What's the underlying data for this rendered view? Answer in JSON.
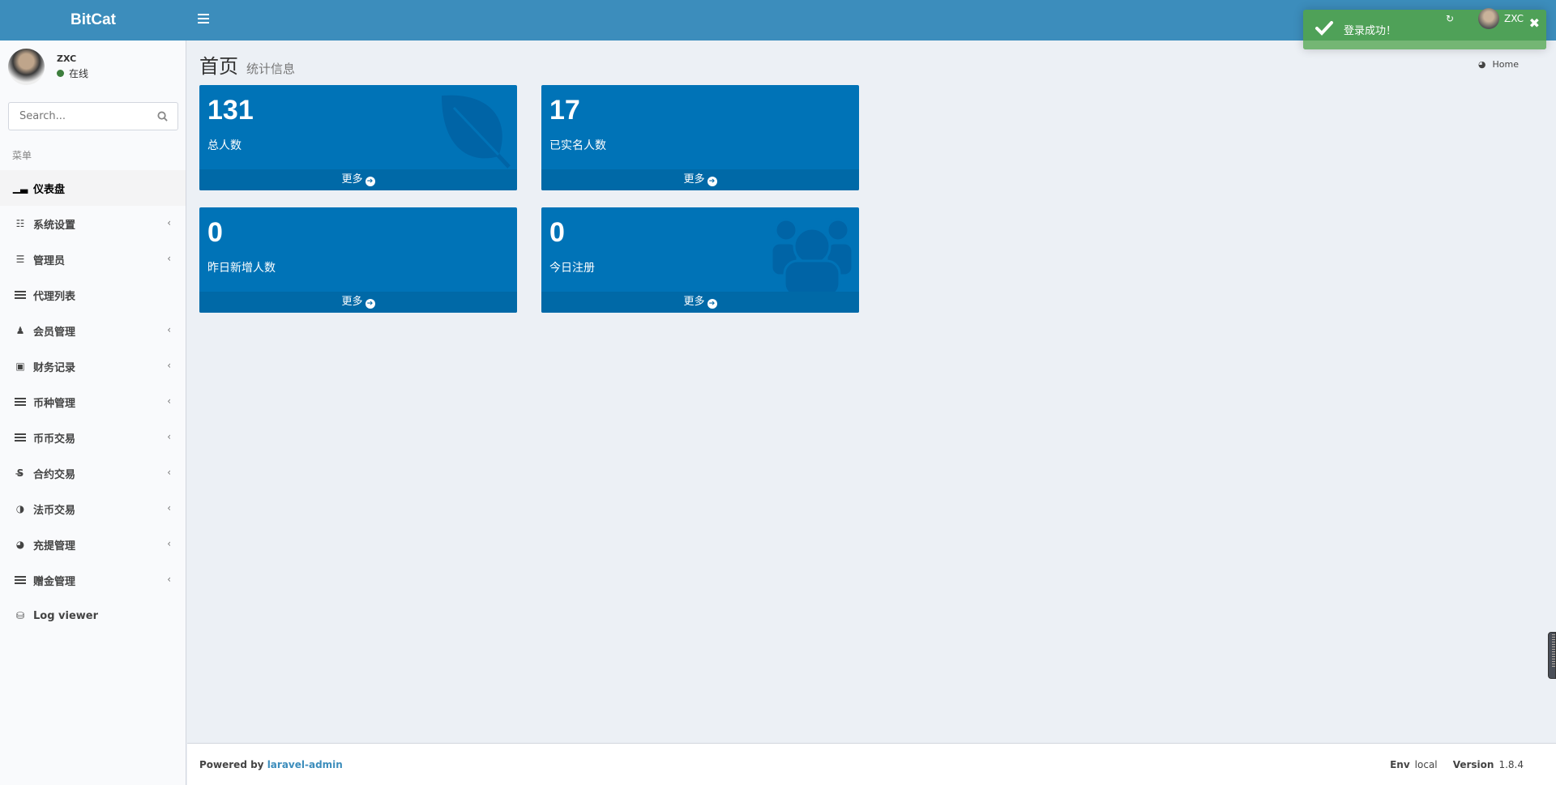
{
  "header": {
    "logo": "BitCat",
    "user_name": "ZXC"
  },
  "sidebar": {
    "user": {
      "name": "ZXC",
      "status": "在线",
      "status_color": "#3d7e3d"
    },
    "search": {
      "placeholder": "Search..."
    },
    "menu_header": "菜单",
    "items": [
      {
        "label": "仪表盘",
        "icon": "bar-chart-icon",
        "active": true,
        "has_children": false
      },
      {
        "label": "系统设置",
        "icon": "sliders-icon",
        "has_children": true
      },
      {
        "label": "管理员",
        "icon": "server-icon",
        "has_children": true
      },
      {
        "label": "代理列表",
        "icon": "bars-icon",
        "has_children": false
      },
      {
        "label": "会员管理",
        "icon": "users-icon",
        "has_children": true
      },
      {
        "label": "财务记录",
        "icon": "money-icon",
        "has_children": true
      },
      {
        "label": "币种管理",
        "icon": "bars-icon",
        "has_children": true
      },
      {
        "label": "币币交易",
        "icon": "bars-icon",
        "has_children": true
      },
      {
        "label": "合约交易",
        "icon": "strikethrough-icon",
        "has_children": true
      },
      {
        "label": "法币交易",
        "icon": "adjust-icon",
        "has_children": true
      },
      {
        "label": "充提管理",
        "icon": "dashboard-icon",
        "has_children": true
      },
      {
        "label": "赠金管理",
        "icon": "bars-icon",
        "has_children": true
      },
      {
        "label": "Log viewer",
        "icon": "database-icon",
        "has_children": false
      }
    ]
  },
  "content": {
    "title": "首页",
    "subtitle": "统计信息",
    "breadcrumb": "Home",
    "cards": [
      {
        "value": "131",
        "label": "总人数",
        "more": "更多",
        "icon": "leaf-icon"
      },
      {
        "value": "17",
        "label": "已实名人数",
        "more": "更多"
      },
      {
        "value": "0",
        "label": "昨日新增人数",
        "more": "更多"
      },
      {
        "value": "0",
        "label": "今日注册",
        "more": "更多",
        "icon": "users-icon"
      }
    ],
    "card_color": "#0073b7"
  },
  "toast": {
    "message": "登录成功！",
    "color": "#51a351"
  },
  "footer": {
    "powered": "Powered by",
    "link": "laravel-admin",
    "env_label": "Env",
    "env": "local",
    "version_label": "Version",
    "version": "1.8.4"
  },
  "colors": {
    "header": "#3c8dbc",
    "link": "#3c8dbc"
  }
}
